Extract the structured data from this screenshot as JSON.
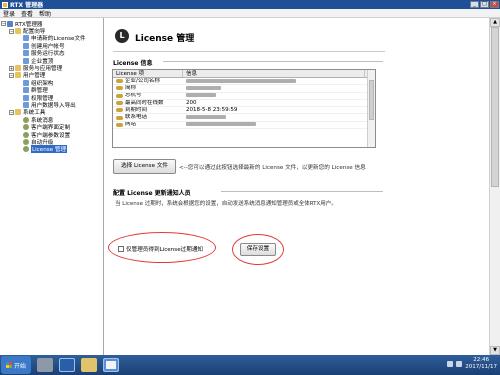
{
  "window": {
    "title": "RTX 管理器"
  },
  "menu": [
    "登录",
    "查看",
    "帮助"
  ],
  "tree": [
    {
      "label": "RTX管理器",
      "depth": 0,
      "exp": "−",
      "icon": "root",
      "selected": false
    },
    {
      "label": "配置向导",
      "depth": 1,
      "exp": "−",
      "icon": "folder",
      "selected": false
    },
    {
      "label": "申请新的License文件",
      "depth": 2,
      "exp": "",
      "icon": "item",
      "selected": false
    },
    {
      "label": "创建用户帐号",
      "depth": 2,
      "exp": "",
      "icon": "item",
      "selected": false
    },
    {
      "label": "服务运行状态",
      "depth": 2,
      "exp": "",
      "icon": "item",
      "selected": false
    },
    {
      "label": "企业置顶",
      "depth": 2,
      "exp": "",
      "icon": "item",
      "selected": false
    },
    {
      "label": "服务与应用管理",
      "depth": 1,
      "exp": "+",
      "icon": "folder",
      "selected": false
    },
    {
      "label": "用户管理",
      "depth": 1,
      "exp": "−",
      "icon": "folder",
      "selected": false
    },
    {
      "label": "组织架构",
      "depth": 2,
      "exp": "",
      "icon": "item",
      "selected": false
    },
    {
      "label": "群管理",
      "depth": 2,
      "exp": "",
      "icon": "item",
      "selected": false
    },
    {
      "label": "权限管理",
      "depth": 2,
      "exp": "",
      "icon": "item",
      "selected": false
    },
    {
      "label": "用户数据导入导出",
      "depth": 2,
      "exp": "",
      "icon": "item",
      "selected": false
    },
    {
      "label": "系统工具",
      "depth": 1,
      "exp": "−",
      "icon": "folder",
      "selected": false
    },
    {
      "label": "系统消息",
      "depth": 2,
      "exp": "",
      "icon": "gear",
      "selected": false
    },
    {
      "label": "客户端界面定制",
      "depth": 2,
      "exp": "",
      "icon": "gear",
      "selected": false
    },
    {
      "label": "客户端参数设置",
      "depth": 2,
      "exp": "",
      "icon": "gear",
      "selected": false
    },
    {
      "label": "自动升级",
      "depth": 2,
      "exp": "",
      "icon": "gear",
      "selected": false
    },
    {
      "label": "License 管理",
      "depth": 2,
      "exp": "",
      "icon": "gear",
      "selected": true
    }
  ],
  "header": {
    "icon_glyph": "L",
    "title": "License 管理"
  },
  "license_info": {
    "section_title": "License 信息",
    "columns": [
      "License 项",
      "信息"
    ],
    "rows": [
      {
        "key": "企业/公司名称",
        "value": "",
        "redacted": 110
      },
      {
        "key": "简称",
        "value": "",
        "redacted": 35
      },
      {
        "key": "总机号",
        "value": "",
        "redacted": 30
      },
      {
        "key": "最高同时在线数",
        "value": "200",
        "redacted": 0
      },
      {
        "key": "到期时间",
        "value": "2018-5-8 23:59:59",
        "redacted": 0
      },
      {
        "key": "联系电话",
        "value": "",
        "redacted": 40
      },
      {
        "key": "网站",
        "value": "",
        "redacted": 70
      }
    ]
  },
  "select_license_button": "选择 License 文件",
  "select_hint": "<--您可以通过此按钮选择最新的 License 文件，以更新您的 License 信息",
  "notify": {
    "section_title": "配置 License 更新通知人员",
    "description": "当 License 过期时，系统会根据您的设置，自动发送系统消息通知管理员或全体RTX用户。",
    "checkbox_label": "仅管理员得到License过期通知",
    "save_button": "保存设置"
  },
  "taskbar": {
    "start_label": "开始",
    "clock_time": "22:46",
    "clock_date": "2017/11/17"
  },
  "colors": {
    "titlebar": "#1f4f97",
    "selection": "#3169c6",
    "annotation": "#e23a3a"
  }
}
